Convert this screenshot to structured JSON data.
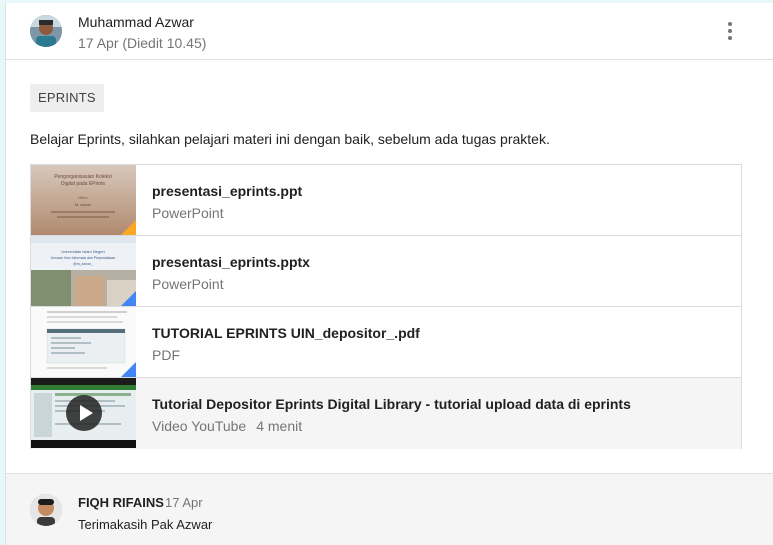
{
  "post": {
    "author_name": "Muhammad Azwar",
    "date": "17 Apr (Diedit 10.45)",
    "topic": "EPRINTS",
    "body": "Belajar Eprints, silahkan pelajari materi ini dengan baik, sebelum ada tugas praktek."
  },
  "attachments": [
    {
      "title": "presentasi_eprints.ppt",
      "type": "PowerPoint",
      "icon": "powerpoint-icon",
      "thumb_lines": [
        "Pengorganisasian Koleksi",
        "Digital pada EPrints",
        "Oleh:",
        "M. azwar"
      ]
    },
    {
      "title": "presentasi_eprints.pptx",
      "type": "PowerPoint",
      "icon": "google-slides-icon",
      "thumb_lines": [
        "Universitas Islam Negeri",
        "Jurusan Ilmu Informasi dan Perpustakaan",
        "@m_azwar_"
      ]
    },
    {
      "title": "TUTORIAL EPRINTS UIN_depositor_.pdf",
      "type": "PDF",
      "icon": "google-docs-icon"
    },
    {
      "title": "Tutorial Depositor Eprints Digital Library - tutorial upload data di eprints",
      "type": "Video YouTube",
      "duration": "4 menit",
      "icon": "play-icon"
    }
  ],
  "comment": {
    "author": "FIQH RIFAINS",
    "date": "17 Apr",
    "text": "Terimakasih Pak Azwar"
  },
  "colors": {
    "powerpoint_corner": "#f9a825",
    "slides_corner": "#4285f4",
    "docs_corner": "#4285f4",
    "youtube_bar": "#2e7d32"
  }
}
